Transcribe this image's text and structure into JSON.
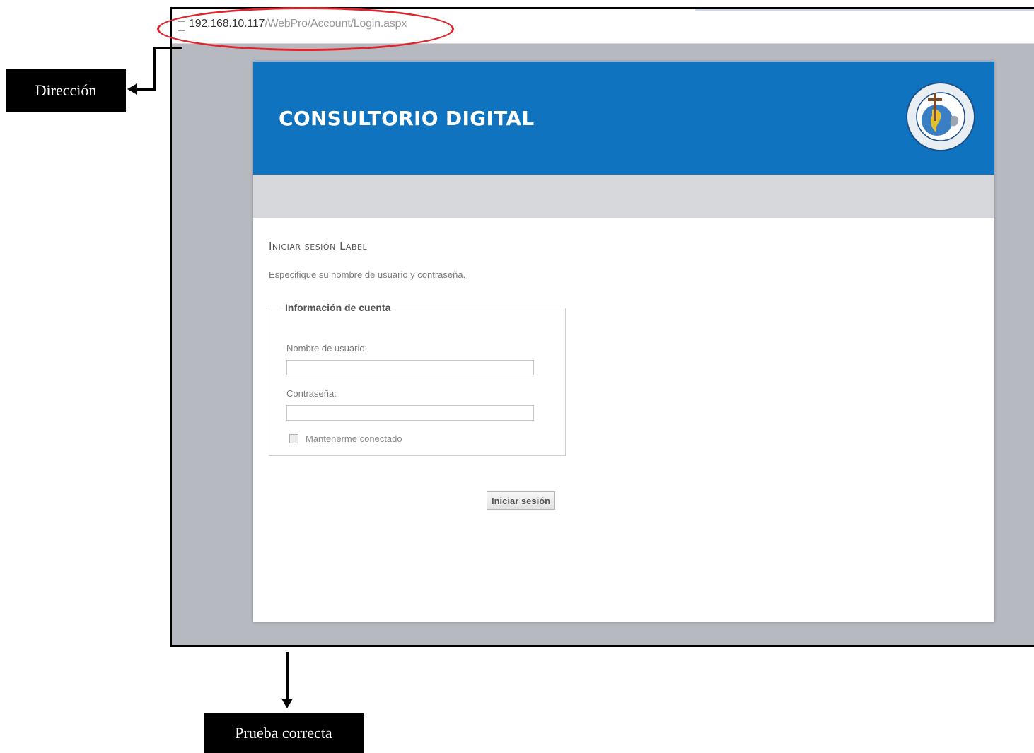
{
  "browser": {
    "url_host": "192.168.10.117",
    "url_path": "/WebPro/Account/Login.aspx"
  },
  "app": {
    "title": "CONSULTORIO DIGITAL",
    "logo_icon": "university-seal-icon",
    "header_color": "#0f73bf"
  },
  "login": {
    "section_title": "Iniciar sesión Label",
    "instructions": "Especifique su nombre de usuario y contraseña.",
    "fieldset_legend": "Información de cuenta",
    "username_label": "Nombre de usuario:",
    "username_value": "",
    "password_label": "Contraseña:",
    "password_value": "",
    "remember_label": "Mantenerme conectado",
    "remember_checked": false,
    "submit_label": "Iniciar sesión"
  },
  "annotations": {
    "address_callout": "Dirección",
    "result_callout": "Prueba correcta",
    "highlight_color": "#e0242d"
  }
}
